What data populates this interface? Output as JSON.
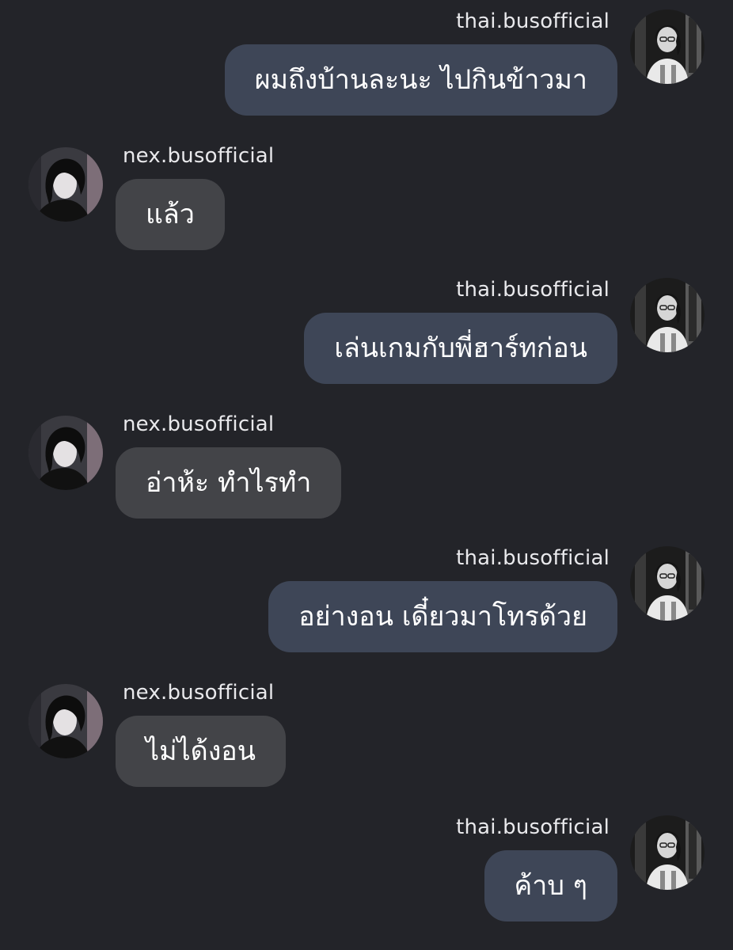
{
  "chat": {
    "messages": [
      {
        "direction": "outgoing",
        "username": "thai.busofficial",
        "text": "ผมถึงบ้านละนะ ไปกินข้าวมา"
      },
      {
        "direction": "incoming",
        "username": "nex.busofficial",
        "text": "แล้ว"
      },
      {
        "direction": "outgoing",
        "username": "thai.busofficial",
        "text": "เล่นเกมกับพี่ฮาร์ทก่อน"
      },
      {
        "direction": "incoming",
        "username": "nex.busofficial",
        "text": "อ่าห้ะ ทำไรทำ"
      },
      {
        "direction": "outgoing",
        "username": "thai.busofficial",
        "text": "อย่างอน เดี๋ยวมาโทรด้วย"
      },
      {
        "direction": "incoming",
        "username": "nex.busofficial",
        "text": "ไม่ได้งอน"
      },
      {
        "direction": "outgoing",
        "username": "thai.busofficial",
        "text": "ค้าบ ๆ"
      }
    ]
  },
  "colors": {
    "background": "#232429",
    "outgoing_bubble": "#3e4657",
    "incoming_bubble": "#434448",
    "text": "#ffffff"
  }
}
